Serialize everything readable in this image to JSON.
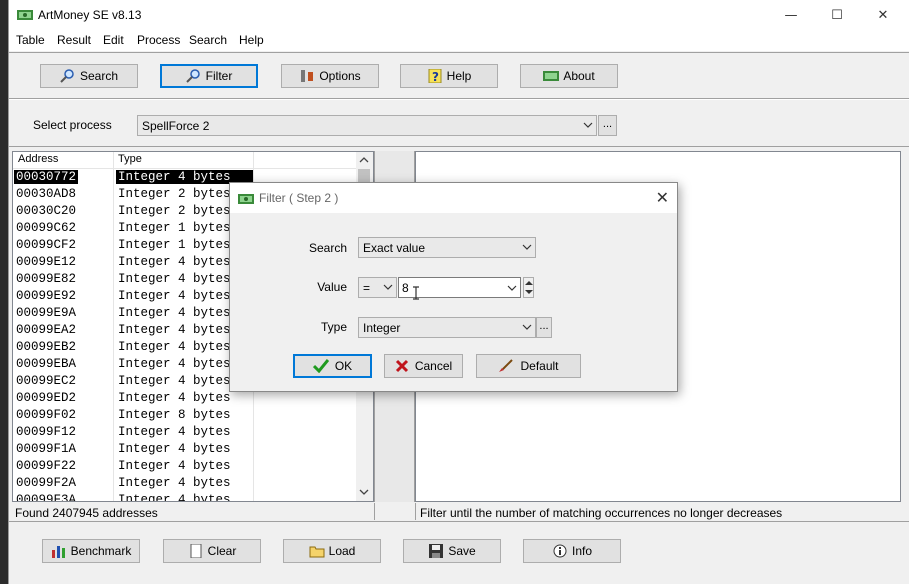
{
  "window": {
    "title": "ArtMoney SE v8.13",
    "controls": {
      "minimize": "—",
      "maximize": "☐",
      "close": "✕"
    }
  },
  "menu": [
    "Table",
    "Result",
    "Edit",
    "Process",
    "Search",
    "Help"
  ],
  "toolbar": {
    "search": "Search",
    "filter": "Filter",
    "options": "Options",
    "help": "Help",
    "about": "About"
  },
  "process": {
    "label": "Select process",
    "value": "SpellForce 2",
    "more": "..."
  },
  "results": {
    "columns": [
      "Address",
      "Type"
    ],
    "rows": [
      {
        "address": "00030772",
        "type": "Integer 4 bytes"
      },
      {
        "address": "00030AD8",
        "type": "Integer 2 bytes"
      },
      {
        "address": "00030C20",
        "type": "Integer 2 bytes"
      },
      {
        "address": "00099C62",
        "type": "Integer 1 bytes"
      },
      {
        "address": "00099CF2",
        "type": "Integer 1 bytes"
      },
      {
        "address": "00099E12",
        "type": "Integer 4 bytes"
      },
      {
        "address": "00099E82",
        "type": "Integer 4 bytes"
      },
      {
        "address": "00099E92",
        "type": "Integer 4 bytes"
      },
      {
        "address": "00099E9A",
        "type": "Integer 4 bytes"
      },
      {
        "address": "00099EA2",
        "type": "Integer 4 bytes"
      },
      {
        "address": "00099EB2",
        "type": "Integer 4 bytes"
      },
      {
        "address": "00099EBA",
        "type": "Integer 4 bytes"
      },
      {
        "address": "00099EC2",
        "type": "Integer 4 bytes"
      },
      {
        "address": "00099ED2",
        "type": "Integer 4 bytes"
      },
      {
        "address": "00099F02",
        "type": "Integer 8 bytes"
      },
      {
        "address": "00099F12",
        "type": "Integer 4 bytes"
      },
      {
        "address": "00099F1A",
        "type": "Integer 4 bytes"
      },
      {
        "address": "00099F22",
        "type": "Integer 4 bytes"
      },
      {
        "address": "00099F2A",
        "type": "Integer 4 bytes"
      },
      {
        "address": "00099F3A",
        "type": "Integer 4 bytes"
      }
    ]
  },
  "status": {
    "found": "Found 2407945 addresses",
    "hint": "Filter until the number of matching occurrences no longer decreases"
  },
  "bottom": {
    "benchmark": "Benchmark",
    "clear": "Clear",
    "load": "Load",
    "save": "Save",
    "info": "Info"
  },
  "dialog": {
    "title": "Filter ( Step 2 )",
    "close": "✕",
    "search_label": "Search",
    "search_value": "Exact value",
    "value_label": "Value",
    "operator": "=",
    "value": "8",
    "type_label": "Type",
    "type_value": "Integer",
    "type_more": "...",
    "ok": "OK",
    "cancel": "Cancel",
    "default": "Default"
  },
  "colors": {
    "accent": "#0078d7",
    "selection": "#000000",
    "ok_check": "#1f9a1f",
    "cancel_x": "#c0141c"
  }
}
